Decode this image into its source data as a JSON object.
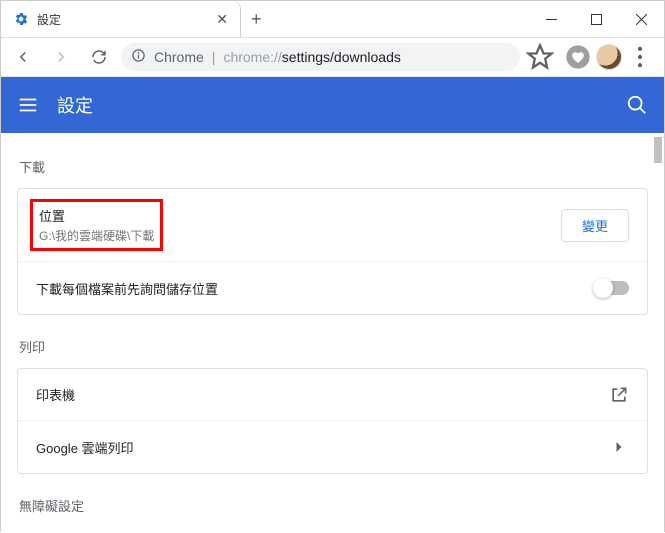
{
  "window": {
    "tab_title": "設定"
  },
  "address": {
    "chrome_label": "Chrome",
    "url_prefix": "chrome://",
    "url_path": "settings/downloads"
  },
  "header": {
    "title": "設定"
  },
  "sections": {
    "downloads": {
      "title": "下載",
      "location": {
        "label": "位置",
        "path": "G:\\我的雲端硬碟\\下載",
        "change_button": "變更"
      },
      "ask_before": {
        "label": "下載每個檔案前先詢問儲存位置"
      }
    },
    "print": {
      "title": "列印",
      "printers": {
        "label": "印表機"
      },
      "cloud_print": {
        "label": "Google 雲端列印"
      }
    },
    "accessibility": {
      "title": "無障礙設定"
    }
  }
}
